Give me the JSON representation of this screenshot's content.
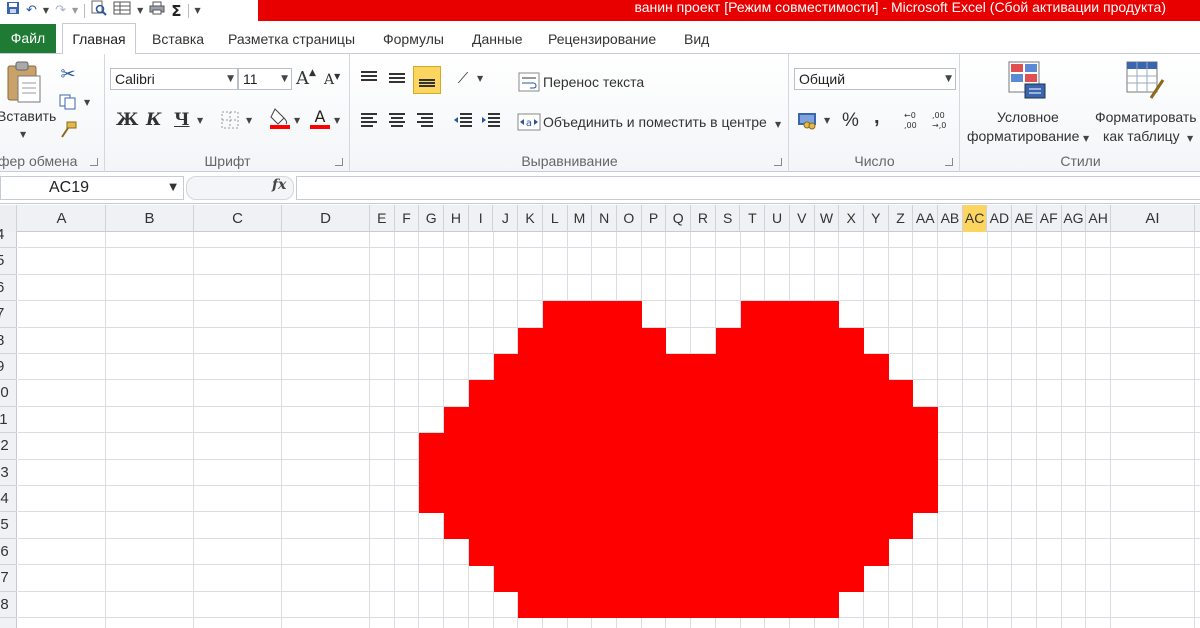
{
  "window": {
    "title": "ванин проект  [Режим совместимости] - Microsoft Excel (Сбой активации продукта)",
    "title_bar_color": "#e80000",
    "quick_access_icons": [
      "save-icon",
      "undo-icon",
      "redo-icon",
      "print-preview-icon",
      "table-icon",
      "print-icon",
      "autosum-icon",
      "customize-icon"
    ]
  },
  "tabs": [
    "Файл",
    "Главная",
    "Вставка",
    "Разметка страницы",
    "Формулы",
    "Данные",
    "Рецензирование",
    "Вид"
  ],
  "active_tab": "Главная",
  "ribbon": {
    "clipboard": {
      "paste_label": "Вставить",
      "group_label": "фер обмена"
    },
    "font": {
      "name": "Calibri",
      "size": "11",
      "bold": "Ж",
      "italic": "К",
      "underline": "Ч",
      "font_color_glyph": "A",
      "group_label": "Шрифт"
    },
    "alignment": {
      "wrap_text": "Перенос текста",
      "merge_center": "Объединить и поместить в центре",
      "group_label": "Выравнивание"
    },
    "number": {
      "format": "Общий",
      "percent": "%",
      "comma": ",",
      "group_label": "Число"
    },
    "styles": {
      "conditional_line1": "Условное",
      "conditional_line2": "форматирование",
      "as_table_line1": "Форматировать",
      "as_table_line2": "как таблицу",
      "group_label": "Стили"
    }
  },
  "formula_bar": {
    "name_box": "AC19",
    "fx": "fx",
    "value": ""
  },
  "sheet": {
    "columns": [
      "A",
      "B",
      "C",
      "D",
      "E",
      "F",
      "G",
      "H",
      "I",
      "J",
      "K",
      "L",
      "M",
      "N",
      "O",
      "P",
      "Q",
      "R",
      "S",
      "T",
      "U",
      "V",
      "W",
      "X",
      "Y",
      "Z",
      "AA",
      "AB",
      "AC",
      "AD",
      "AE",
      "AF",
      "AG",
      "AH",
      "AI"
    ],
    "selected_column": "AC",
    "rows": [
      "4",
      "5",
      "6",
      "7",
      "8",
      "9",
      "10",
      "11",
      "12",
      "13",
      "14",
      "15",
      "16",
      "17",
      "18"
    ],
    "fill_color": "#ff0000"
  }
}
